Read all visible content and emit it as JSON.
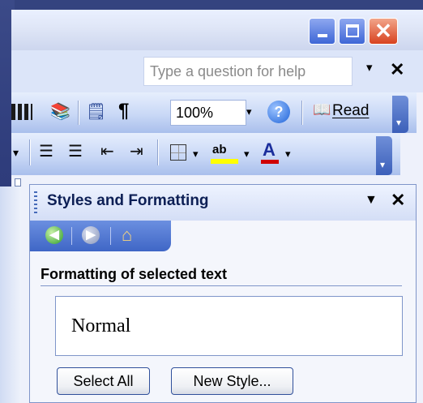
{
  "window": {
    "controls": {
      "minimize_icon": "minimize-icon",
      "maximize_icon": "maximize-icon",
      "close_glyph": "✕"
    }
  },
  "menubar": {
    "help_placeholder": "Type a question for help",
    "help_dropdown_glyph": "▾",
    "doc_close_glyph": "✕"
  },
  "toolbar_standard": {
    "zoom_value": "100%",
    "zoom_dropdown_glyph": "▾",
    "help_glyph": "?",
    "read_label": "Read",
    "paragraph_glyph": "¶"
  },
  "toolbar_formatting": {
    "highlight_glyph": "ab",
    "font_color_glyph": "A"
  },
  "task_pane": {
    "title": "Styles and Formatting",
    "menu_glyph": "▼",
    "close_glyph": "✕",
    "nav": {
      "back_glyph": "◀",
      "forward_glyph": "▶",
      "home_glyph": "⌂"
    },
    "section_label": "Formatting of selected text",
    "current_style": "Normal",
    "buttons": {
      "select_all": "Select All",
      "new_style": "New Style..."
    }
  },
  "colors": {
    "accent": "#3f66c6",
    "close_button": "#d8421f",
    "highlight_yellow": "#ffff00",
    "font_color_red": "#d00000"
  }
}
